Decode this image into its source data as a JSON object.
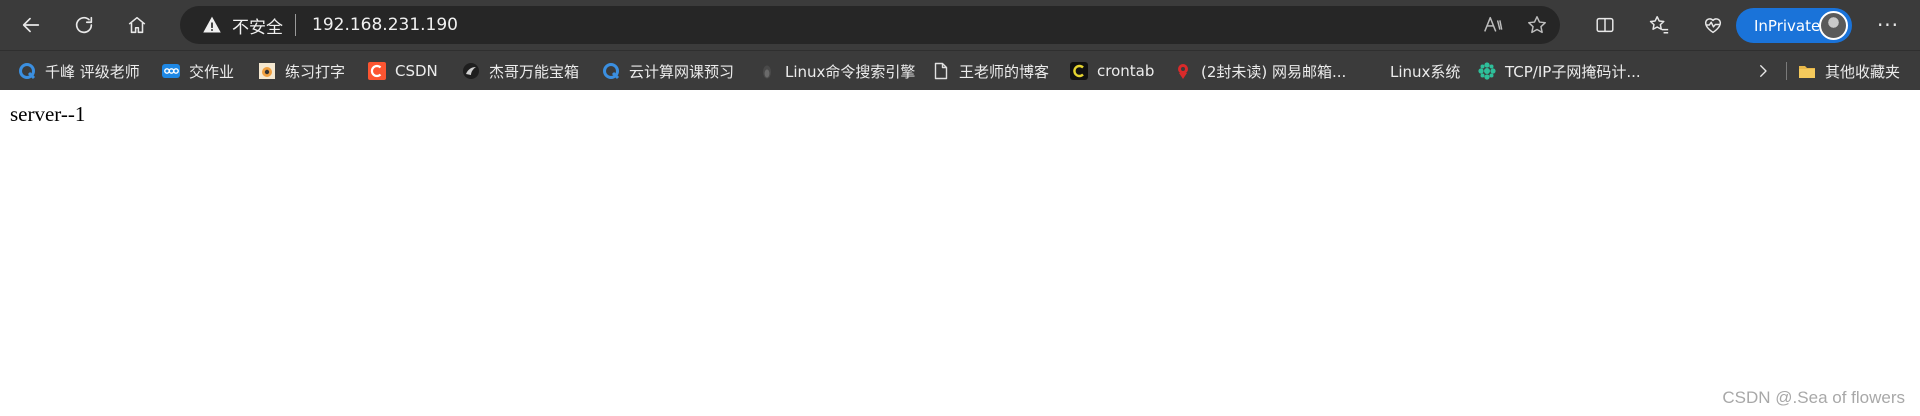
{
  "browser": {
    "address_bar": {
      "security_label": "不安全",
      "url": "192.168.231.190"
    },
    "profile_label": "InPrivate",
    "more_label": "···"
  },
  "bookmarks": [
    {
      "label": "千峰 评级老师",
      "icon": "qf-logo-icon",
      "color": "#3b8fe0"
    },
    {
      "label": "交作业",
      "icon": "nextcloud-icon",
      "color": "#1e88e5"
    },
    {
      "label": "练习打字",
      "icon": "typing-icon",
      "color": "#f0a040"
    },
    {
      "label": "CSDN",
      "icon": "csdn-icon",
      "color": "#fc5531"
    },
    {
      "label": "杰哥万能宝箱",
      "icon": "toolbox-icon",
      "color": "#cccccc"
    },
    {
      "label": "云计算网课预习",
      "icon": "qf-logo-icon",
      "color": "#3b8fe0"
    },
    {
      "label": "Linux命令搜索引擎",
      "icon": "linux-icon",
      "color": "#888888"
    },
    {
      "label": "王老师的博客",
      "icon": "page-icon",
      "color": "#dddddd"
    },
    {
      "label": "crontab",
      "icon": "crontab-icon",
      "color": "#e5d430"
    },
    {
      "label": "(2封未读) 网易邮箱...",
      "icon": "netease-mail-icon",
      "color": "#d92a2a"
    },
    {
      "label": "Linux系统",
      "icon": "",
      "color": ""
    },
    {
      "label": "TCP/IP子网掩码计...",
      "icon": "subnet-calc-icon",
      "color": "#2ebf9a"
    }
  ],
  "other_bookmarks_label": "其他收藏夹",
  "page": {
    "body_text": "server--1"
  },
  "watermark": "CSDN @.Sea of flowers"
}
